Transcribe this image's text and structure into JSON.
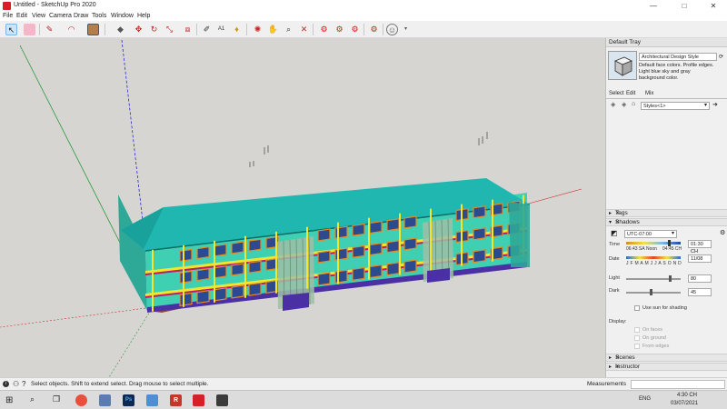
{
  "window": {
    "title": "Untitled - SketchUp Pro 2020",
    "minimize": "—",
    "maximize": "□",
    "close": "✕"
  },
  "menu": [
    "File",
    "Edit",
    "View",
    "Camera",
    "Draw",
    "Tools",
    "Window",
    "Help"
  ],
  "tray": {
    "title": "Default Tray",
    "style_name": "Architectural Design Style",
    "style_desc": "Default face colors. Profile edges. Light blue sky and gray background color.",
    "tabs": [
      "Select",
      "Edit",
      "Mix"
    ],
    "styles_dropdown": "Styles<1>",
    "tags_label": "Tags",
    "shadows_label": "Shadows",
    "timezone": "UTC-07:00",
    "time_label": "Time",
    "time_start": "06:43 SA",
    "time_noon": "Noon",
    "time_end": "04:45 CH",
    "time_value": "01:30 CH",
    "date_label": "Date",
    "months": "J F M A M J J A S O N D",
    "date_value": "11/08",
    "light_label": "Light",
    "light_value": "80",
    "dark_label": "Dark",
    "dark_value": "45",
    "use_sun": "Use sun for shading",
    "display_label": "Display:",
    "on_faces": "On faces",
    "on_ground": "On ground",
    "from_edges": "From edges",
    "scenes_label": "Scenes",
    "instructor_label": "Instructor",
    "sun_fraction": 0.79,
    "light_fraction": 0.8,
    "dark_fraction": 0.45
  },
  "status": {
    "message": "Select objects. Shift to extend select. Drag mouse to select multiple.",
    "measurements_label": "Measurements"
  },
  "taskbar": {
    "time": "4:30 CH",
    "date": "03/07/2021",
    "lang": "ENG"
  },
  "colors": {
    "roof": "#1fb7b0",
    "wall": "#3fd0b4",
    "trim_yellow": "#f2e52a",
    "floor_band": "#c2186b",
    "base_purple": "#4b2fa5",
    "window_frame": "#e68a22"
  }
}
